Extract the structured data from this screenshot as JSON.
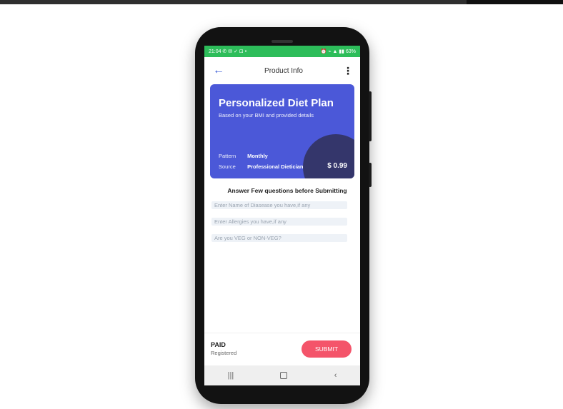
{
  "status_bar": {
    "time": "21:04",
    "left_icons": "✆ ✉ ✓ ⊡ •",
    "right_icons": "⏰ ⌁ ▲ ▮▮ 63%"
  },
  "app_bar": {
    "title": "Product Info"
  },
  "card": {
    "title": "Personalized Diet Plan",
    "subtitle": "Based on your BMI and provided details",
    "pattern_label": "Pattern",
    "pattern_value": "Monthly",
    "source_label": "Source",
    "source_value": "Professional Dietician",
    "price": "$ 0.99",
    "color": "#4b58d8",
    "accent_dark": "#34366b"
  },
  "questions": {
    "heading": "Answer Few questions before Submitting",
    "disease_placeholder": "Enter Name of Diasease you have,if any",
    "allergies_placeholder": "Enter Allergies you have,if any",
    "diet_placeholder": "Are you VEG or NON-VEG?"
  },
  "footer": {
    "status": "PAID",
    "status_sub": "Registered",
    "submit_label": "SUBMIT",
    "submit_color": "#f4546a"
  },
  "nav": {
    "recents": "|||",
    "back": "‹"
  },
  "colors": {
    "status_bar": "#2dbd5a",
    "back_arrow": "#3d5fd6"
  }
}
